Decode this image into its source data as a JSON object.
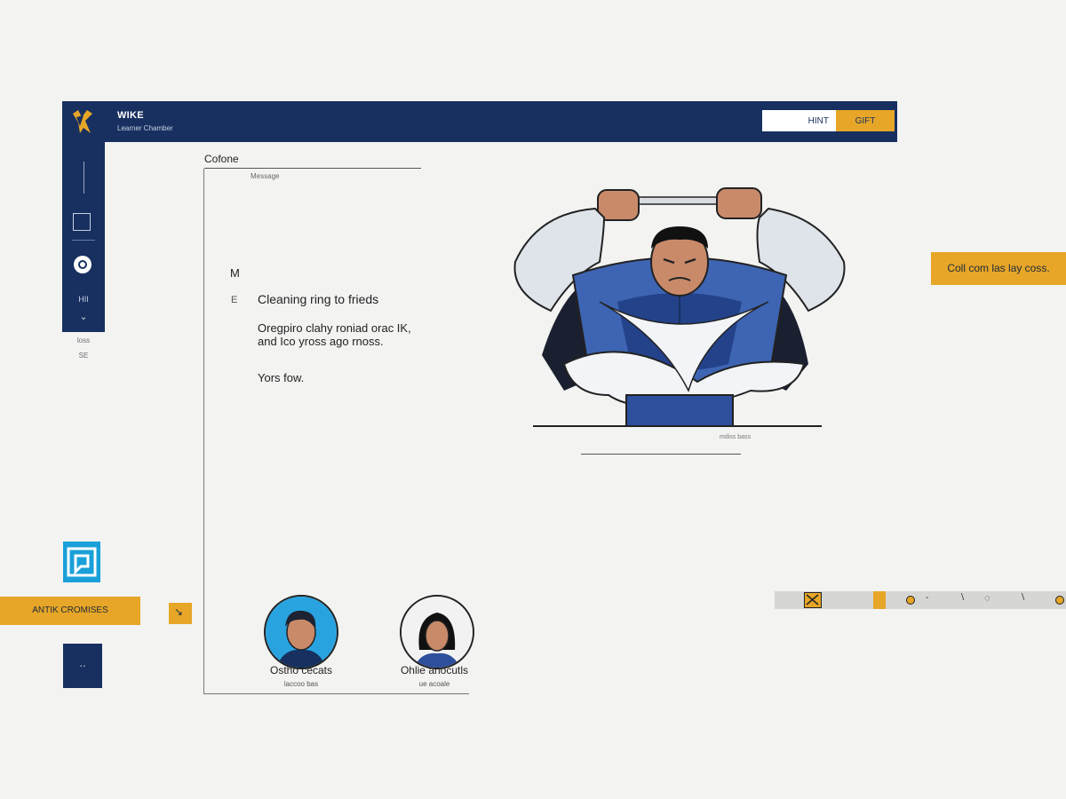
{
  "header": {
    "app_name": "WIKE",
    "app_subtitle": "Learner Chamber",
    "hint_label": "HINT",
    "gift_label": "GIFT"
  },
  "sidebar": {
    "item_label": "HII",
    "chevron": "⌄",
    "footer_line1": "loss",
    "footer_line2": "SE"
  },
  "panel": {
    "title": "Cofone",
    "label": "Message",
    "m_letter": "M",
    "e_letter": "E",
    "heading": "Cleaning ring to frieds",
    "body_line1": "Oregpiro clahy roniad orac IK,",
    "body_line2": "and Ico yross ago rnoss.",
    "signoff": "Yors fow."
  },
  "hero": {
    "caption": "mdiss bass"
  },
  "callout": {
    "text": "Coll com las lay coss."
  },
  "left_widgets": {
    "banner_text": "ANTIK CROMISES",
    "chip_glyph": "↘",
    "navy_glyph": "․․"
  },
  "avatars": [
    {
      "name": "Ostho cecats",
      "role": "laccoo bas"
    },
    {
      "name": "Ohlie anocutls",
      "role": "ue acoale"
    }
  ],
  "toolbar": {
    "tick1": "‐",
    "tick2": "∖",
    "drop_glyph": "◌",
    "tick3": "∖"
  },
  "colors": {
    "navy": "#17305f",
    "accent": "#e7a627",
    "cyan": "#1aa0d8",
    "background": "#f3f3f2"
  }
}
